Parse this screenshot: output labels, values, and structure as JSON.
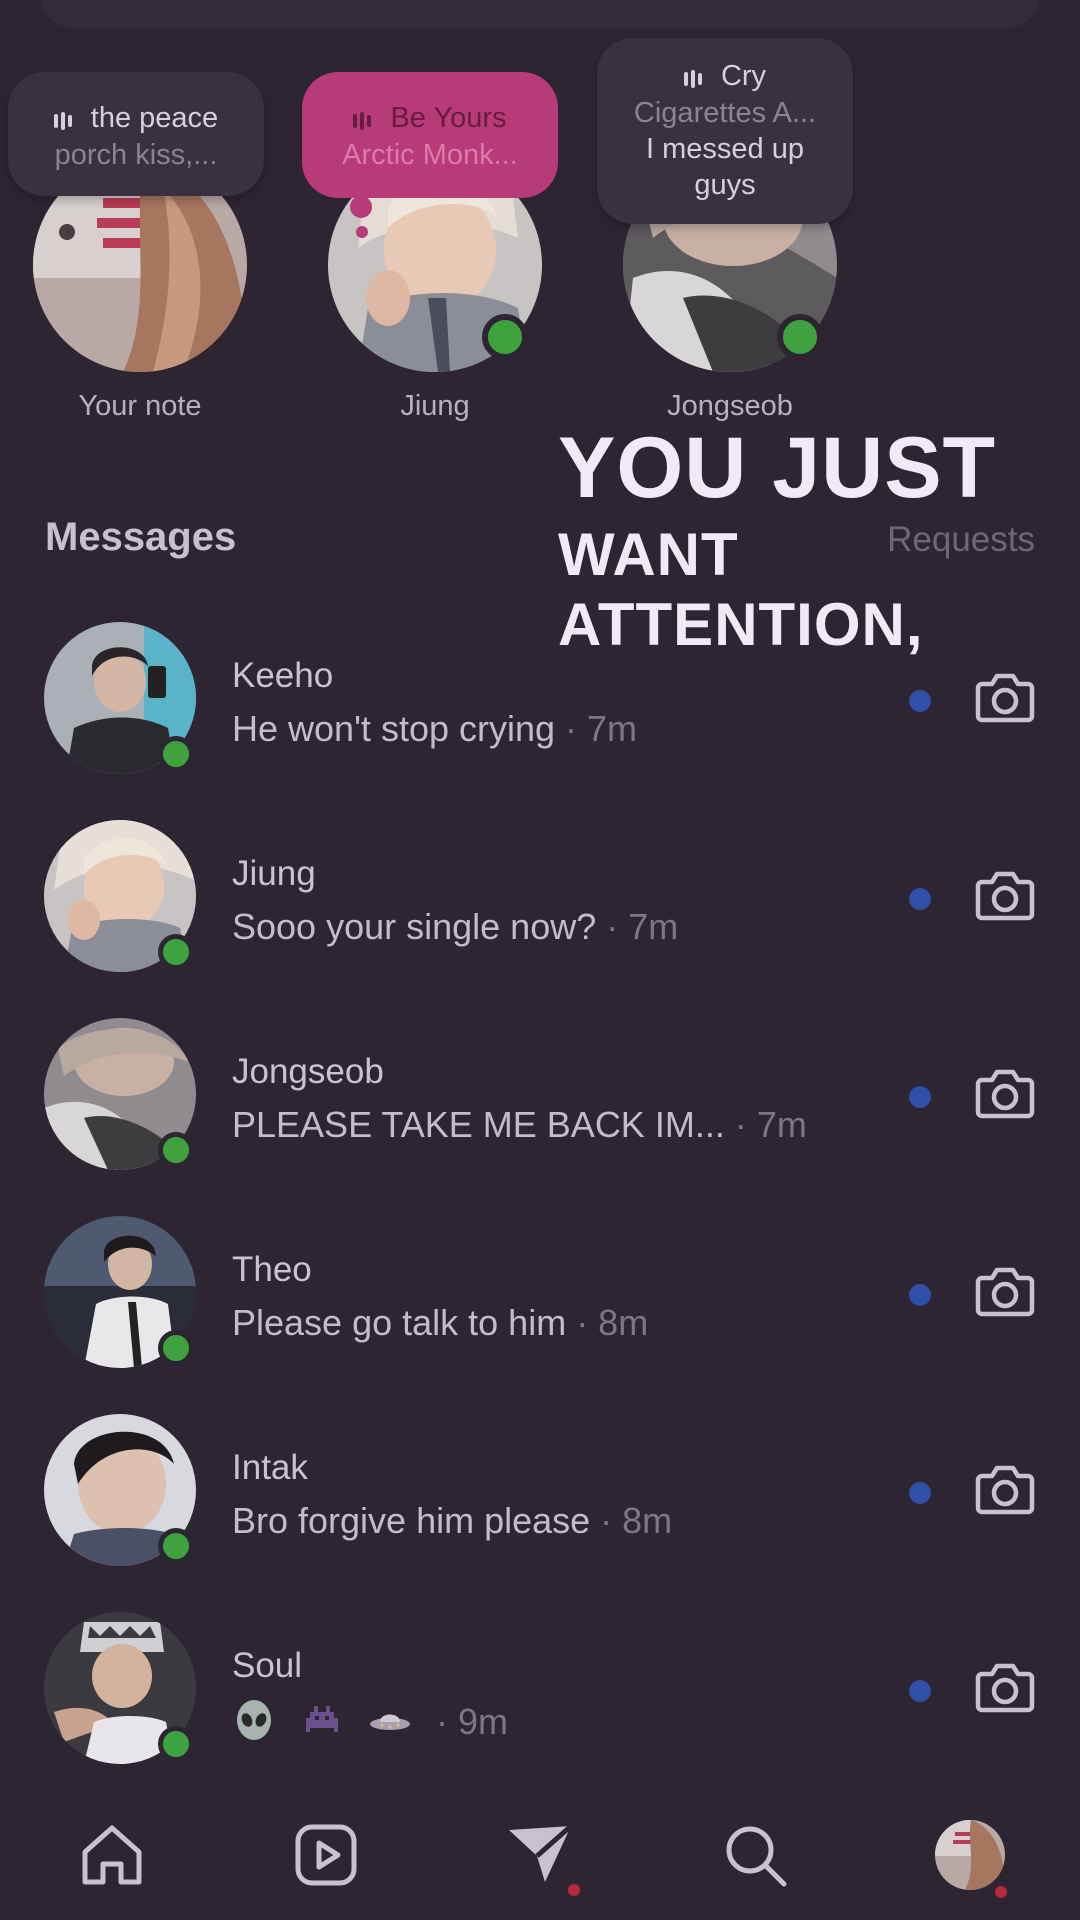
{
  "notes": [
    {
      "track": "the peace",
      "artist": "porch kiss,...",
      "label": "Your note",
      "online": false
    },
    {
      "track": "Be Yours",
      "artist": "Arctic Monk...",
      "label": "Jiung",
      "online": true
    },
    {
      "track": "Cry",
      "artist": "Cigarettes A...",
      "caption_line1": "I messed up",
      "caption_line2": "guys",
      "label": "Jongseob",
      "online": true
    }
  ],
  "header": {
    "title": "Messages",
    "requests": "Requests"
  },
  "overlay": {
    "line1": "YOU JUST",
    "line2": "WANT",
    "line3": "ATTENTION,"
  },
  "conversations": [
    {
      "name": "Keeho",
      "message": "He won't stop crying",
      "time": " · 7m"
    },
    {
      "name": "Jiung",
      "message": "Sooo your single now?",
      "time": " · 7m"
    },
    {
      "name": "Jongseob",
      "message": "PLEASE TAKE ME BACK IM...",
      "time": "  · 7m"
    },
    {
      "name": "Theo",
      "message": "Please go talk to him",
      "time": " · 8m"
    },
    {
      "name": "Intak",
      "message": "Bro forgive him please",
      "time": " · 8m"
    },
    {
      "name": "Soul",
      "message": "",
      "time": " · 9m",
      "emoji": [
        "alien-emoji",
        "alien-monster-emoji",
        "ufo-emoji"
      ]
    }
  ],
  "nav": [
    "home-icon",
    "reels-icon",
    "direct-icon",
    "search-icon",
    "profile-avatar"
  ],
  "colors": {
    "background": "#2e2533",
    "online": "#3ea23e",
    "unread": "#2f4fa8",
    "note_pink": "#b73a79"
  }
}
